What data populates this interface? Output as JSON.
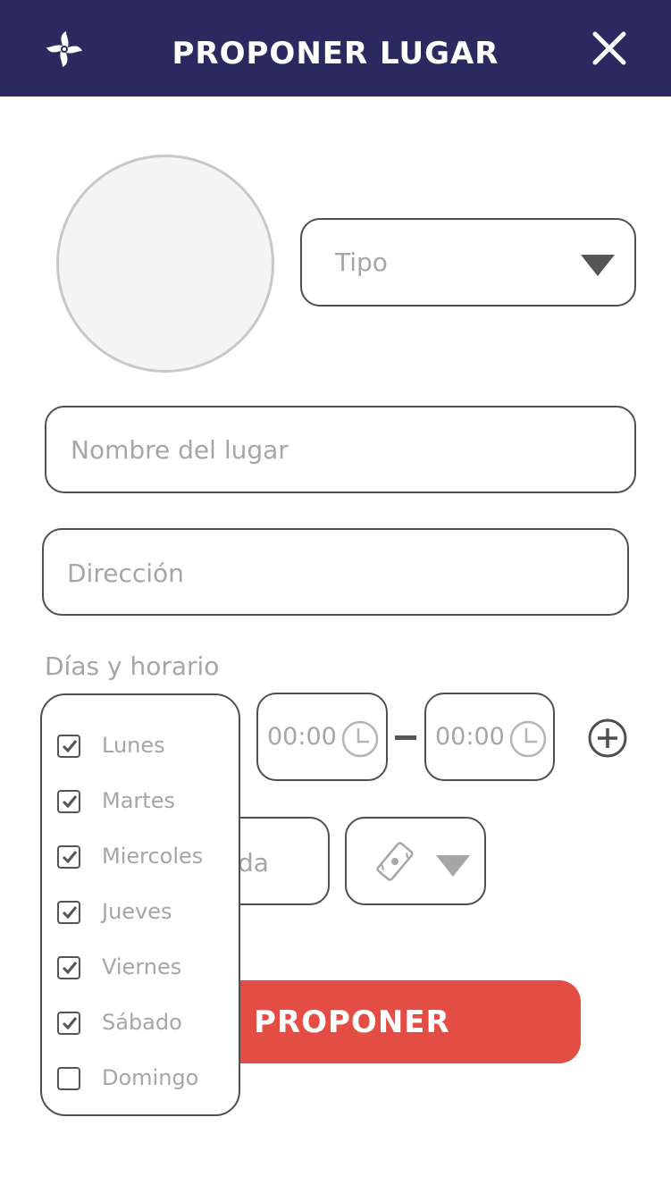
{
  "header": {
    "title": "PROPONER LUGAR",
    "logo_icon": "pinwheel-logo-icon",
    "close_icon": "close-icon",
    "background": "#2b2a60"
  },
  "form": {
    "photo_icon": "photo-placeholder",
    "tipo": {
      "placeholder": "Tipo",
      "icon": "chevron-down-icon"
    },
    "nombre": {
      "placeholder": "Nombre del lugar"
    },
    "direccion": {
      "placeholder": "Dirección"
    },
    "schedule": {
      "label": "Días y horario",
      "start_time": "00:00",
      "end_time": "00:00",
      "separator": "–",
      "clock_icon": "clock-icon",
      "add_icon": "plus-circle-icon"
    },
    "precio": {
      "visible_text": "da"
    },
    "moneda": {
      "icon": "money-icon",
      "arrow_icon": "chevron-down-icon"
    },
    "submit_label": "PROPONER",
    "submit_color": "#e44d44"
  },
  "days": [
    {
      "label": "Lunes",
      "checked": true
    },
    {
      "label": "Martes",
      "checked": true
    },
    {
      "label": "Miercoles",
      "checked": true
    },
    {
      "label": "Jueves",
      "checked": true
    },
    {
      "label": "Viernes",
      "checked": true
    },
    {
      "label": "Sábado",
      "checked": true
    },
    {
      "label": "Domingo",
      "checked": false
    }
  ]
}
